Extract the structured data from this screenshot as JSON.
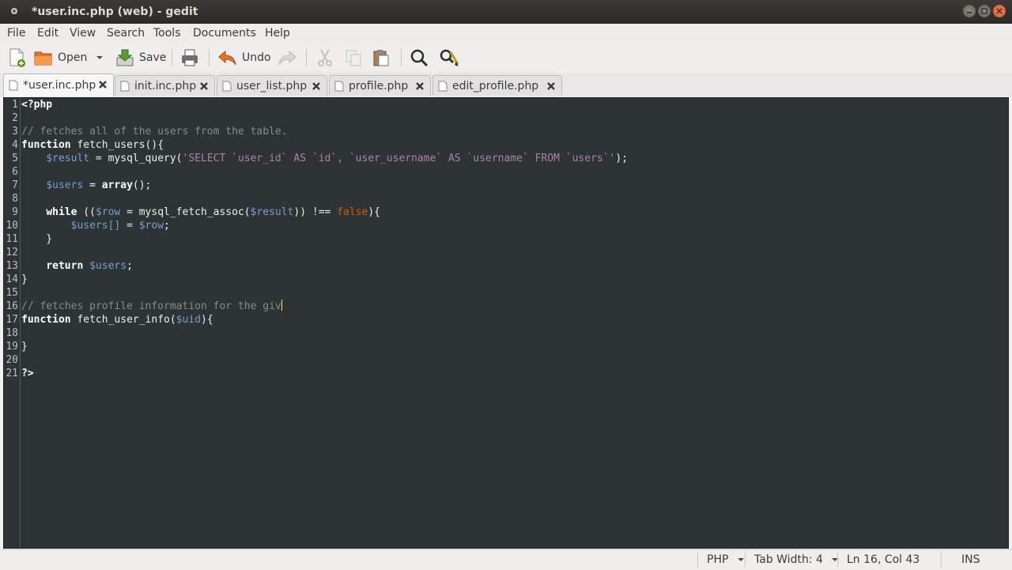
{
  "window": {
    "title": "*user.inc.php (web) - gedit"
  },
  "menu": [
    "File",
    "Edit",
    "View",
    "Search",
    "Tools",
    "Documents",
    "Help"
  ],
  "toolbar": {
    "open_label": "Open",
    "save_label": "Save",
    "undo_label": "Undo"
  },
  "tabs": [
    {
      "label": "*user.inc.php",
      "active": true
    },
    {
      "label": "init.inc.php",
      "active": false
    },
    {
      "label": "user_list.php",
      "active": false
    },
    {
      "label": "profile.php",
      "active": false
    },
    {
      "label": "edit_profile.php",
      "active": false
    }
  ],
  "editor": {
    "lines": [
      [
        [
          "kw",
          "<?php"
        ]
      ],
      [],
      [
        [
          "cm",
          "// fetches all of the users from the table."
        ]
      ],
      [
        [
          "kw",
          "function"
        ],
        [
          "fn",
          " fetch_users(){"
        ]
      ],
      [
        [
          "fn",
          "    "
        ],
        [
          "var",
          "$result"
        ],
        [
          "fn",
          " = mysql_query("
        ],
        [
          "str",
          "'SELECT `user_id` AS `id`, `user_username` AS `username` FROM `users`'"
        ],
        [
          "fn",
          ");"
        ]
      ],
      [],
      [
        [
          "fn",
          "    "
        ],
        [
          "var",
          "$users"
        ],
        [
          "fn",
          " = "
        ],
        [
          "kw",
          "array"
        ],
        [
          "fn",
          "();"
        ]
      ],
      [],
      [
        [
          "fn",
          "    "
        ],
        [
          "kw",
          "while"
        ],
        [
          "fn",
          " (("
        ],
        [
          "var",
          "$row"
        ],
        [
          "fn",
          " = mysql_fetch_assoc("
        ],
        [
          "var",
          "$result"
        ],
        [
          "fn",
          ")) !== "
        ],
        [
          "fls",
          "false"
        ],
        [
          "fn",
          "){"
        ]
      ],
      [
        [
          "fn",
          "        "
        ],
        [
          "var",
          "$users[]"
        ],
        [
          "fn",
          " = "
        ],
        [
          "var",
          "$row"
        ],
        [
          "fn",
          ";"
        ]
      ],
      [
        [
          "fn",
          "    }"
        ]
      ],
      [],
      [
        [
          "fn",
          "    "
        ],
        [
          "kw",
          "return"
        ],
        [
          "fn",
          " "
        ],
        [
          "var",
          "$users"
        ],
        [
          "fn",
          ";"
        ]
      ],
      [
        [
          "fn",
          "}"
        ]
      ],
      [],
      [
        [
          "cm",
          "// fetches profile information for the giv"
        ],
        [
          "cursor",
          ""
        ]
      ],
      [
        [
          "kw",
          "function"
        ],
        [
          "fn",
          " fetch_user_info("
        ],
        [
          "var",
          "$uid"
        ],
        [
          "fn",
          "){"
        ]
      ],
      [],
      [
        [
          "fn",
          "}"
        ]
      ],
      [],
      [
        [
          "kw",
          "?>"
        ]
      ]
    ]
  },
  "status": {
    "language": "PHP",
    "tab_width": "Tab Width:  4",
    "position": "Ln 16, Col 43",
    "mode": "INS"
  },
  "colors": {
    "editor_bg": "#2e3436",
    "comment": "#888a85",
    "string": "#ad7fa8",
    "variable": "#729fcf",
    "false": "#ce5c00"
  }
}
